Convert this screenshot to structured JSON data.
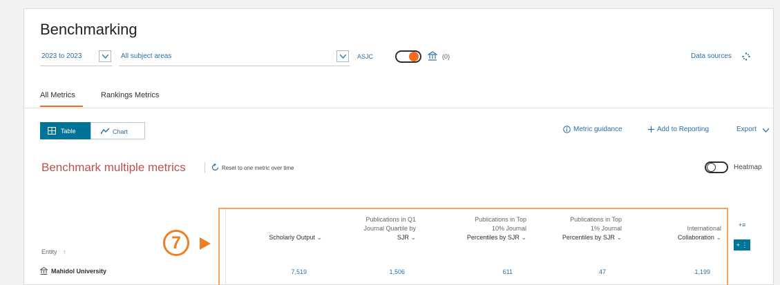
{
  "header": {
    "title": "Benchmarking"
  },
  "filters": {
    "year_range": "2023 to 2023",
    "subject_areas": "All subject areas",
    "classification": "ASJC",
    "institution_count": "(0)",
    "data_sources": "Data sources"
  },
  "tabs": [
    {
      "label": "All Metrics",
      "active": true
    },
    {
      "label": "Rankings Metrics",
      "active": false
    }
  ],
  "view_toggle": {
    "table_label": "Table",
    "chart_label": "Chart",
    "selected": "Table"
  },
  "actions": {
    "metric_guidance": "Metric guidance",
    "add_to_reporting": "Add to Reporting",
    "export": "Export"
  },
  "benchmark": {
    "title": "Benchmark multiple metrics",
    "reset_label": "Reset to one metric over time",
    "heatmap_label": "Heatmap",
    "heatmap_on": false
  },
  "step_marker": "7",
  "table": {
    "entity_header": "Entity",
    "sort_icon": "arrow-up-icon",
    "columns": [
      {
        "line1": "",
        "line2": "",
        "line3": "Scholarly Output"
      },
      {
        "line1": "Publications in Q1",
        "line2": "Journal Quartile by",
        "line3": "SJR"
      },
      {
        "line1": "Publications in Top",
        "line2": "10% Journal",
        "line3": "Percentiles by SJR"
      },
      {
        "line1": "Publications in Top",
        "line2": "1% Journal",
        "line3": "Percentiles by SJR"
      },
      {
        "line1": "",
        "line2": "International",
        "line3": "Collaboration"
      }
    ],
    "rows": [
      {
        "entity": "Mahidol University",
        "values": [
          "7,519",
          "1,506",
          "611",
          "47",
          "1,199"
        ]
      }
    ]
  },
  "side_buttons": {
    "add_metric": "+≡",
    "add_entity": "+ ⋮"
  },
  "colors": {
    "accent_orange": "#ef7d22",
    "primary_blue": "#007398",
    "link_blue": "#2b6ea6",
    "title_red": "#c0504d"
  }
}
